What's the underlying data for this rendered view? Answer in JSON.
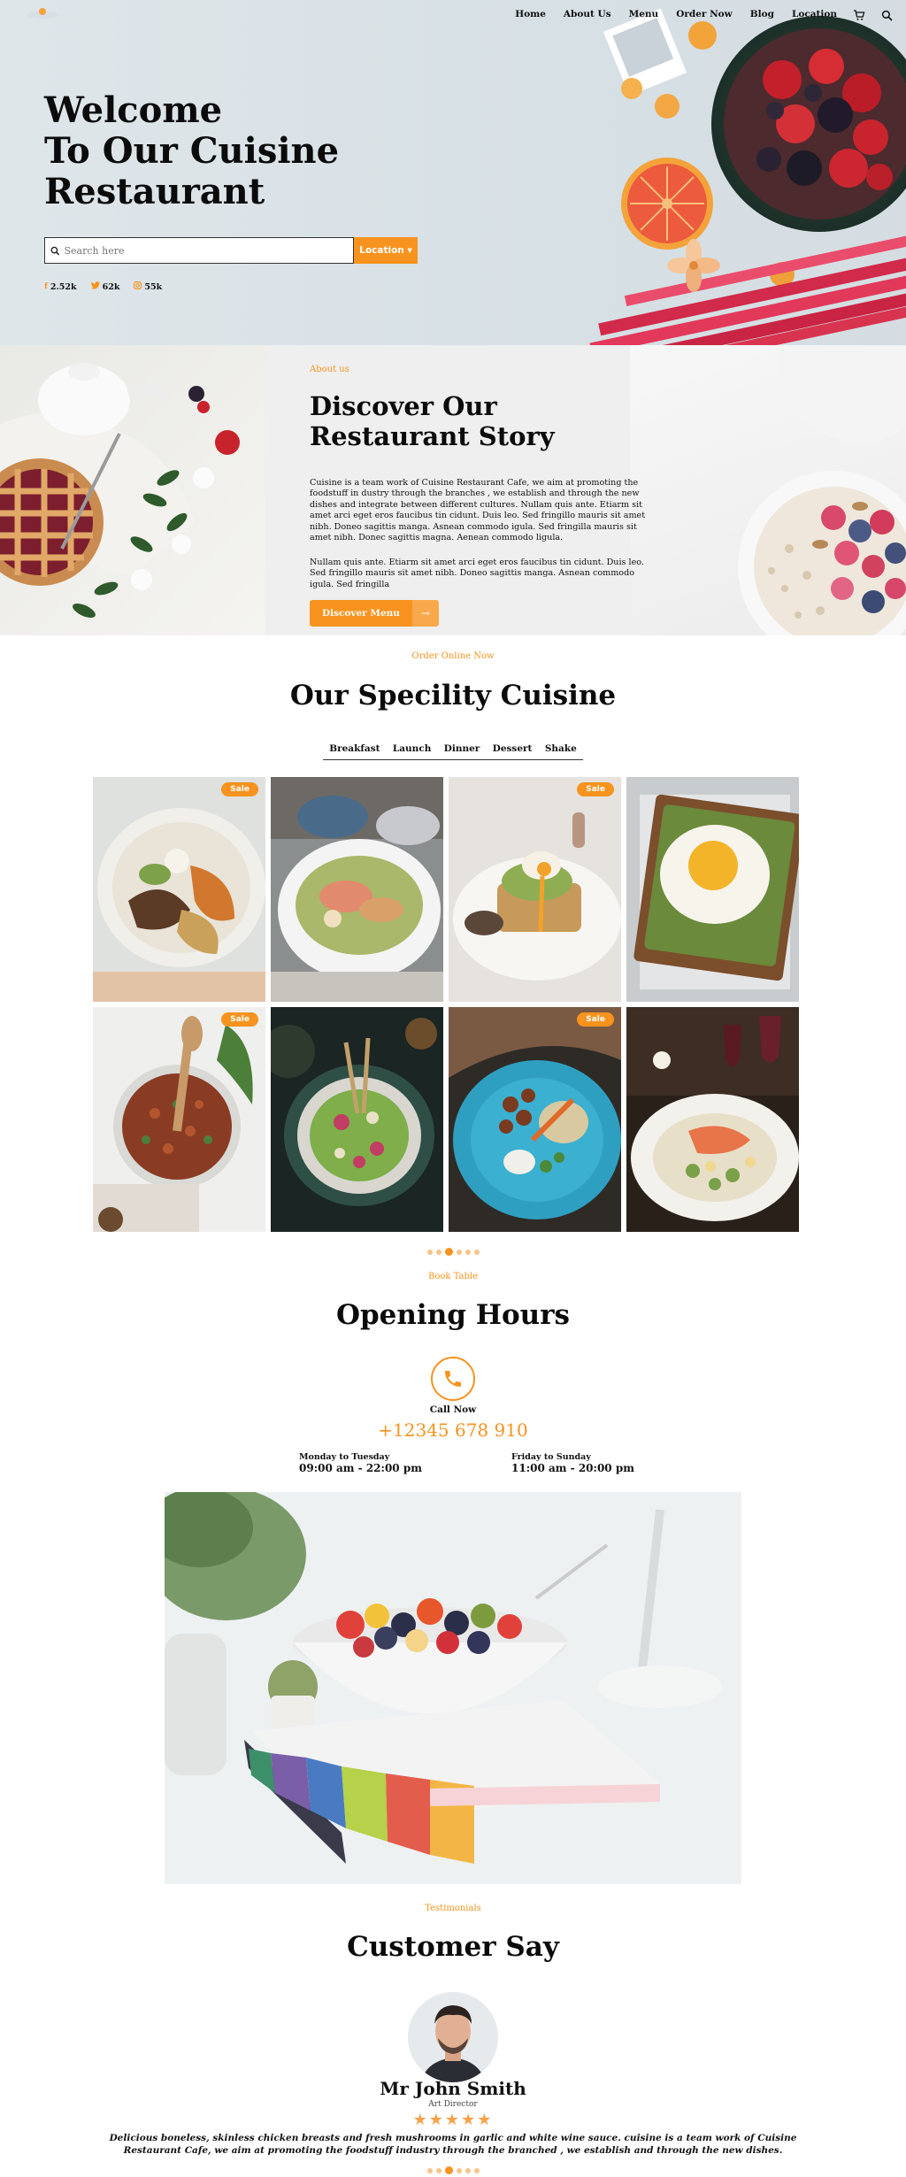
{
  "nav": {
    "items": [
      "Home",
      "About Us",
      "Menu",
      "Order Now",
      "Blog",
      "Location"
    ],
    "icons": [
      "cart-icon",
      "search-icon"
    ]
  },
  "hero": {
    "title_lines": [
      "Welcome",
      "To Our Cuisine",
      "Restaurant"
    ],
    "search_placeholder": "Search here",
    "location_button": "Location ▾",
    "socials": [
      {
        "icon": "facebook-icon",
        "count": "2.52k"
      },
      {
        "icon": "twitter-icon",
        "count": "62k"
      },
      {
        "icon": "instagram-icon",
        "count": "55k"
      }
    ]
  },
  "about": {
    "kicker": "About us",
    "title_lines": [
      "Discover Our",
      "Restaurant Story"
    ],
    "paragraph1": "Cuisine is a team work of Cuisine Restaurant Cafe, we aim at promoting the foodstuff in dustry through the branches , we establish and through the new dishes and integrate between different cultures. Nullam quis ante. Etiarm sit amet arci eget eros faucibus tin cidunt. Duis leo. Sed fringillo mauris sit amet nibh. Doneo sagittis manga. Asnean commodo igula. Sed fringilla mauris sit amet nibh. Donec sagittis magna. Aenean commodo ligula.",
    "paragraph2": "Nullam quis ante. Etiarm sit amet arci eget eros faucibus tin cidunt. Duis leo. Sed fringillo mauris sit amet nibh. Doneo sagittis manga. Asnean commodo igula. Sed fringilla",
    "button": "Discover Menu",
    "button_arrow": "→"
  },
  "speciality": {
    "kicker": "Order Online Now",
    "title": "Our Specility Cuisine",
    "tabs": [
      "Breakfast",
      "Launch",
      "Dinner",
      "Dessert",
      "Shake"
    ],
    "sale_label": "Sale",
    "items": [
      {
        "name": "grain-bowl-with-vegetables",
        "sale": true
      },
      {
        "name": "salmon-salad-bowl",
        "sale": false
      },
      {
        "name": "egg-avocado-toast",
        "sale": true
      },
      {
        "name": "fried-egg-toast",
        "sale": false
      },
      {
        "name": "bean-stew-pot",
        "sale": true
      },
      {
        "name": "green-salad-plate",
        "sale": false
      },
      {
        "name": "chickpea-vegetable-bowl",
        "sale": true
      },
      {
        "name": "salmon-dinner-plate",
        "sale": false
      }
    ]
  },
  "opening": {
    "kicker": "Book Table",
    "title": "Opening Hours",
    "call_label": "Call Now",
    "phone": "+12345 678 910",
    "hours": [
      {
        "days": "Monday to Tuesday",
        "time": "09:00 am - 22:00 pm"
      },
      {
        "days": "Friday to Sunday",
        "time": "11:00 am - 20:00 pm"
      }
    ]
  },
  "testimonials": {
    "kicker": "Testimonials",
    "title": "Customer Say",
    "name": "Mr John Smith",
    "role": "Art Director",
    "rating": 5,
    "stars": "★★★★★",
    "quote": "Delicious boneless, skinless chicken breasts and fresh mushrooms in garlic and white wine sauce. cuisine is a team work of Cuisine Restaurant Cafe, we aim at promoting the foodstuff industry through the branched , we establish and through the new dishes."
  },
  "colors": {
    "accent": "#f7931e",
    "hero_bg": "#dde4e8",
    "text": "#111111"
  }
}
